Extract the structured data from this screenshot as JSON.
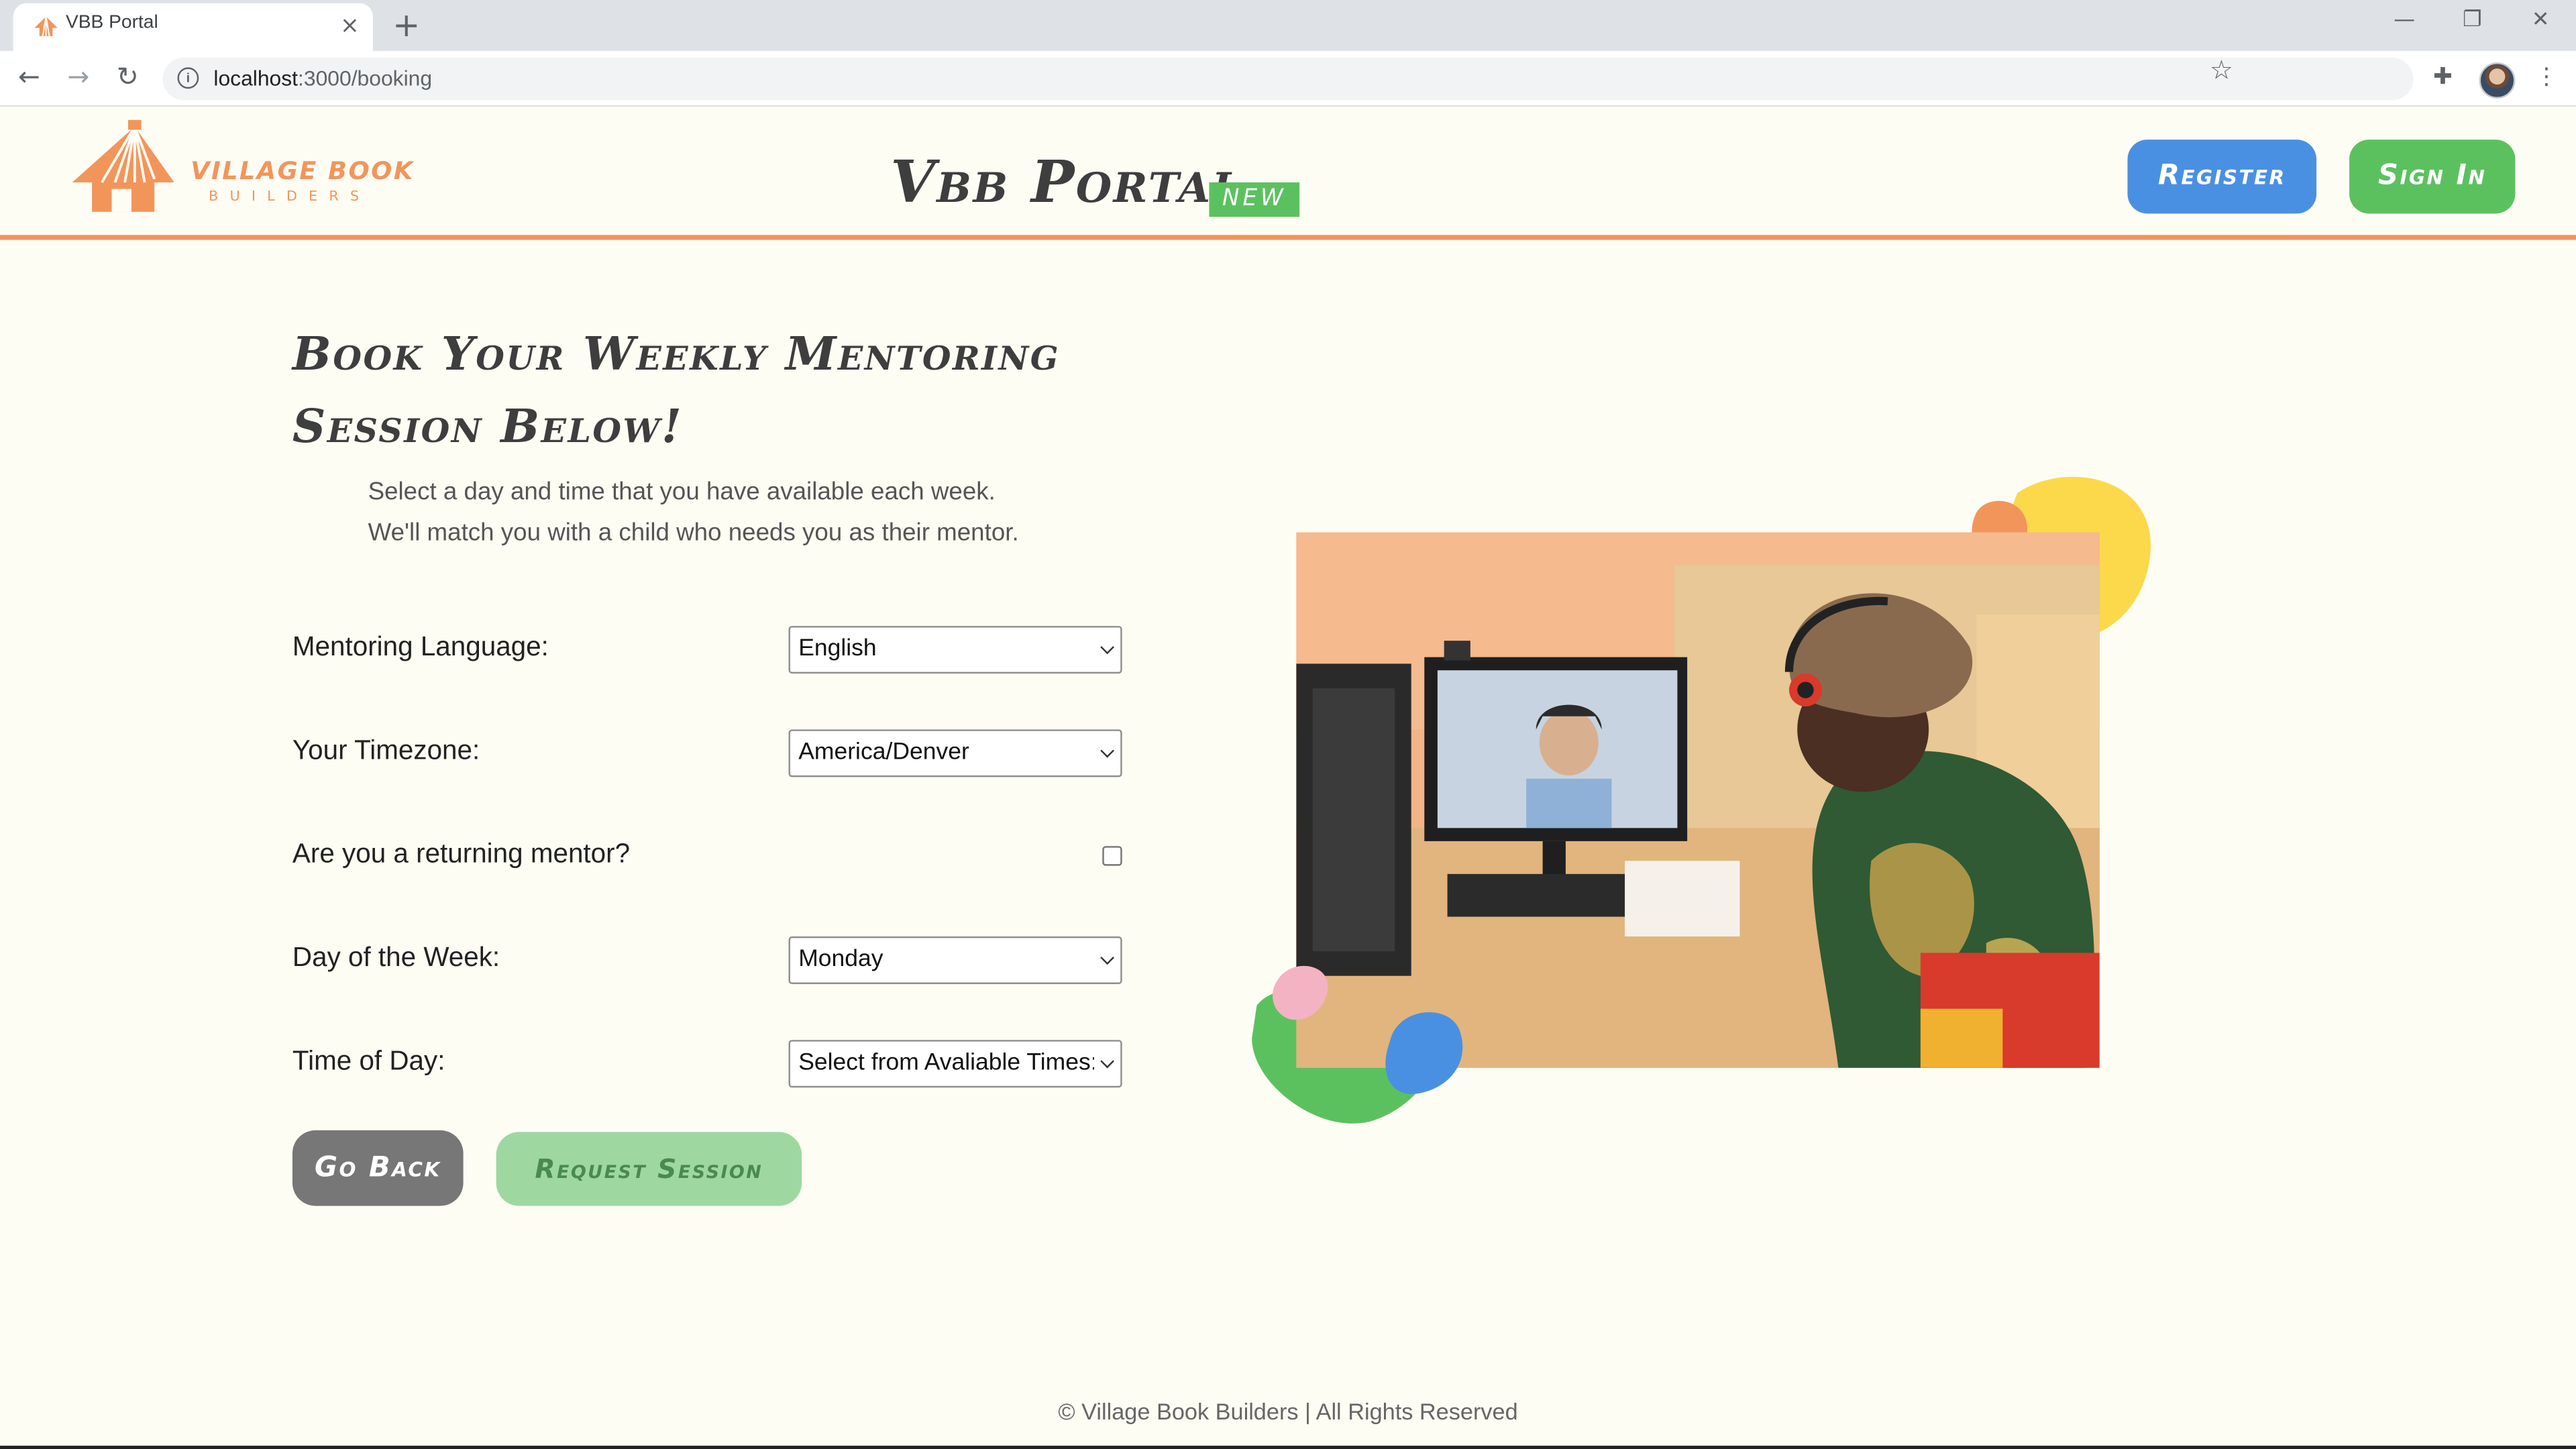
{
  "browser": {
    "tab_title": "VBB Portal",
    "tab_close": "×",
    "new_tab": "+",
    "url_host": "localhost",
    "url_rest": ":3000/booking"
  },
  "header": {
    "logo_line1": "VILLAGE BOOK",
    "logo_line2": "BUILDERS",
    "title": "Vbb Portal",
    "badge": "NEW",
    "register_label": "Register",
    "signin_label": "Sign In"
  },
  "booking": {
    "title": "Book Your Weekly Mentoring Session Below!",
    "subtitle_line1": "Select a day and time that you have available each week.",
    "subtitle_line2": "We'll match you with a child who needs you as their mentor.",
    "fields": {
      "language": {
        "label": "Mentoring Language:",
        "value": "English"
      },
      "timezone": {
        "label": "Your Timezone:",
        "value": "America/Denver"
      },
      "returning": {
        "label": "Are you a returning mentor?",
        "checked": false
      },
      "day": {
        "label": "Day of the Week:",
        "value": "Monday"
      },
      "time": {
        "label": "Time of Day:",
        "value": "Select from Avaliable Times:"
      }
    },
    "back_label": "Go Back",
    "request_label": "Request Session"
  },
  "colors": {
    "brand_orange": "#f2955b",
    "register_blue": "#4a90e2",
    "signin_green": "#5bc15f",
    "request_green_disabled": "#9ed8a0",
    "back_gray": "#777777",
    "page_background": "#fefdf4"
  },
  "icons": {
    "back": "arrow-left-icon",
    "forward": "arrow-right-icon",
    "reload": "reload-icon",
    "site_info": "info-icon",
    "bookmark": "star-icon",
    "extensions": "puzzle-icon",
    "menu": "kebab-menu-icon"
  },
  "footer": {
    "text": "© Village Book Builders | All Rights Reserved"
  }
}
